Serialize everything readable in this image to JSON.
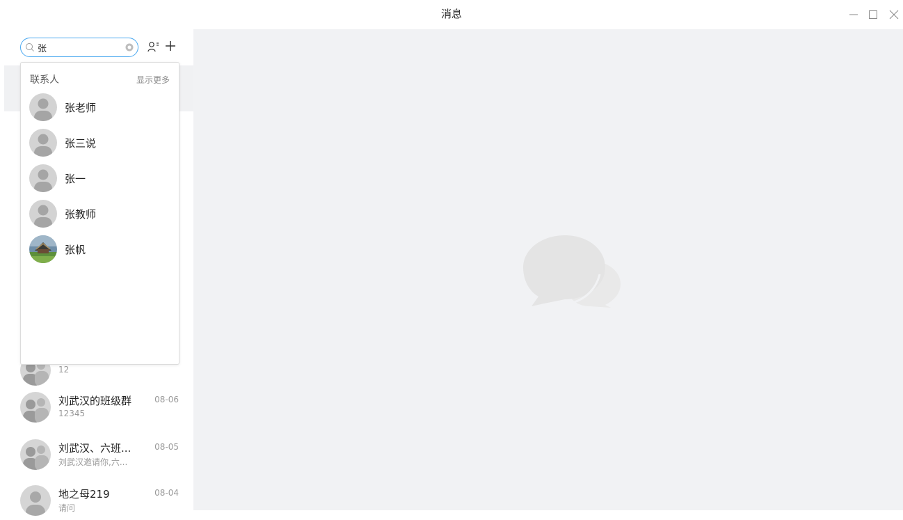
{
  "window": {
    "title": "消息",
    "minimize_icon": "minimize-icon",
    "maximize_icon": "maximize-icon",
    "close_icon": "close-icon"
  },
  "search": {
    "value": "张",
    "icon": "search-icon",
    "clear_icon": "clear-icon",
    "contacts_icon": "contacts-icon",
    "add_icon": "plus-icon"
  },
  "dropdown": {
    "section_title": "联系人",
    "show_more": "显示更多",
    "contacts": [
      {
        "name": "张老师",
        "avatar": "default-avatar"
      },
      {
        "name": "张三说",
        "avatar": "default-avatar"
      },
      {
        "name": "张一",
        "avatar": "default-avatar"
      },
      {
        "name": "张教师",
        "avatar": "default-avatar"
      },
      {
        "name": "张帆",
        "avatar": "photo-avatar"
      }
    ]
  },
  "conversations": [
    {
      "name": "",
      "preview": "12",
      "time": "",
      "avatar": "group-avatar"
    },
    {
      "name": "刘武汉的班级群",
      "preview": "12345",
      "time": "08-06",
      "avatar": "group-avatar"
    },
    {
      "name": "刘武汉、六班...",
      "preview": "刘武汉邀请你,六...",
      "time": "08-05",
      "avatar": "group-avatar"
    },
    {
      "name": "地之母219",
      "preview": "请问",
      "time": "08-04",
      "avatar": "default-avatar"
    }
  ],
  "main": {
    "empty_icon": "chat-bubbles-icon"
  },
  "colors": {
    "accent": "#4aa8f0",
    "main_bg": "#f1f2f4",
    "avatar_gray": "#c8c8c8",
    "bubble": "#e6e6e6"
  }
}
